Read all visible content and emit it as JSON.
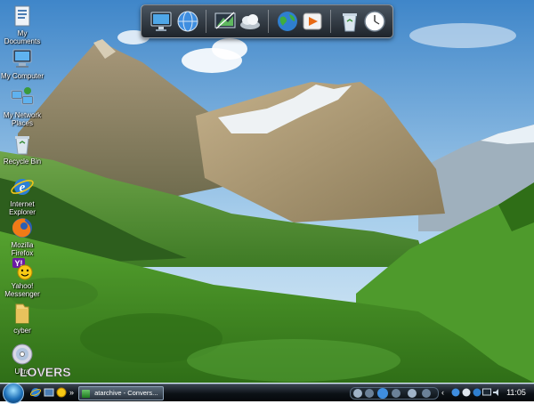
{
  "desktop": {
    "icons": [
      {
        "label": "My Documents",
        "icon": "folder-documents-icon"
      },
      {
        "label": "My Computer",
        "icon": "computer-icon"
      },
      {
        "label": "My Network Places",
        "icon": "network-icon"
      },
      {
        "label": "Recycle Bin",
        "icon": "recycle-bin-icon"
      },
      {
        "label": "Internet Explorer",
        "icon": "internet-explorer-icon"
      },
      {
        "label": "Mozilla Firefox",
        "icon": "firefox-icon"
      },
      {
        "label": "Yahoo! Messenger",
        "icon": "yahoo-messenger-icon"
      },
      {
        "label": "cyber",
        "icon": "folder-icon"
      },
      {
        "label": "Ultra",
        "icon": "disc-icon"
      }
    ]
  },
  "dock": {
    "items": [
      "monitor-icon",
      "globe-icon",
      "display-settings-icon",
      "cloud-drive-icon",
      "earth-icon",
      "media-player-icon",
      "recycle-bin-icon",
      "clock-icon"
    ]
  },
  "watermark": {
    "text": "LOVERS"
  },
  "taskbar": {
    "task_label": "atarchive - Convers...",
    "chevron": "»",
    "clock": "11:05",
    "tray_chevron": "‹"
  },
  "colors": {
    "sky": "#c9e3f4",
    "grass": "#3f8f24",
    "taskbar": "#0c1116"
  }
}
